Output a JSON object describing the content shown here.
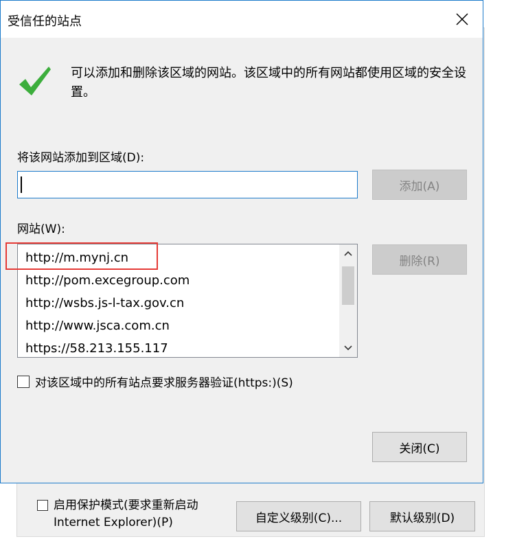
{
  "dialog": {
    "title": "受信任的站点",
    "info": "可以添加和删除该区域的网站。该区域中的所有网站都使用区域的安全设置。",
    "add_label": "将该网站添加到区域(D):",
    "input_value": "",
    "add_button": "添加(A)",
    "sites_label": "网站(W):",
    "sites": [
      "http://m.mynj.cn",
      "http://pom.excegroup.com",
      "http://wsbs.js-l-tax.gov.cn",
      "http://www.jsca.com.cn",
      "https://58.213.155.117"
    ],
    "remove_button": "删除(R)",
    "verify_label": "对该区域中的所有站点要求服务器验证(https:)(S)",
    "close_button": "关闭(C)"
  },
  "background": {
    "protected_mode_label": "启用保护模式(要求重新启动 Internet Explorer)(P)",
    "custom_level_button": "自定义级别(C)...",
    "default_level_button": "默认级别(D)"
  },
  "colors": {
    "accent": "#1979ca",
    "check_green": "#3cae3c",
    "highlight_red": "#e53935"
  },
  "icons": {
    "close": "close-icon",
    "check": "checkmark-icon",
    "scroll_up": "chevron-up-icon",
    "scroll_down": "chevron-down-icon"
  }
}
